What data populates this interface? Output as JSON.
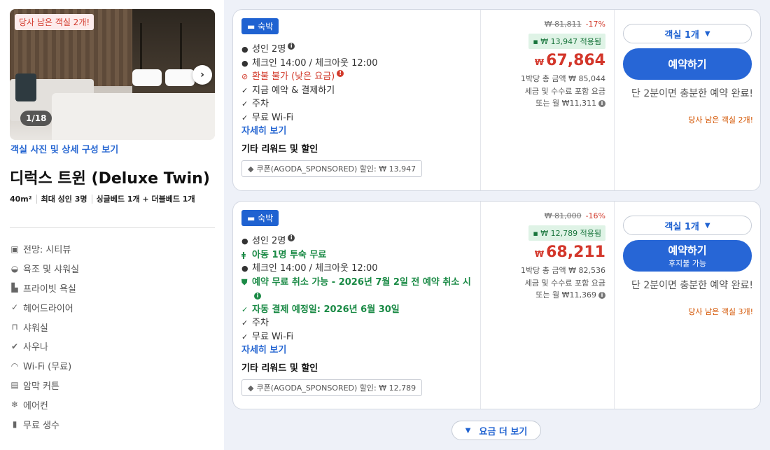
{
  "room": {
    "scarcity_badge": "당사 남은 객실 2개!",
    "photo_counter": "1/18",
    "photo_link": "객실 사진 및 상세 구성 보기",
    "title": "디럭스 트윈 (Deluxe Twin)",
    "specs": [
      "40m²",
      "최대 성인 3명",
      "싱글베드 1개 + 더블베드 1개"
    ],
    "amenities": [
      {
        "icon": "view-icon",
        "label": "전망: 시티뷰"
      },
      {
        "icon": "bathtub-icon",
        "label": "욕조 및 샤워실"
      },
      {
        "icon": "toilet-icon",
        "label": "프라이빗 욕실"
      },
      {
        "icon": "check-icon",
        "label": "헤어드라이어"
      },
      {
        "icon": "shower-icon",
        "label": "샤워실"
      },
      {
        "icon": "check-circle-icon",
        "label": "사우나"
      },
      {
        "icon": "wifi-icon",
        "label": "Wi-Fi (무료)"
      },
      {
        "icon": "curtain-icon",
        "label": "암막 커튼"
      },
      {
        "icon": "snowflake-icon",
        "label": "에어컨"
      },
      {
        "icon": "bottle-icon",
        "label": "무료 생수"
      }
    ]
  },
  "offers": [
    {
      "stay_badge": "숙박",
      "adults": "성인 2명",
      "checkin": "체크인 14:00 / 체크아웃 12:00",
      "refund": "환불 불가 (낮은 요금)",
      "pay_now": "지금 예약 & 결제하기",
      "parking": "주차",
      "wifi": "무료 Wi-Fi",
      "details_link": "자세히 보기",
      "extra_title": "기타 리워드 및 할인",
      "coupon": "쿠폰(AGODA_SPONSORED) 할인: ₩ 13,947",
      "old_price": "₩ 81,811",
      "discount_pct": "-17%",
      "applied": "₩ 13,947 적용됨",
      "currency": "₩",
      "price": "67,864",
      "total_note": "1박당 총 금액 ₩ 85,044",
      "tax_note": "세금 및 수수료 포함 요금",
      "monthly_note": "또는 월 ₩11,311",
      "qty": "객실 1개",
      "book_label": "예약하기",
      "hurry": "단 2분이면 충분한 예약 완료!",
      "rooms_left": "당사 남은 객실 2개!"
    },
    {
      "stay_badge": "숙박",
      "adults": "성인 2명",
      "child": "아동 1명 투숙 무료",
      "checkin": "체크인 14:00 / 체크아웃 12:00",
      "free_cancel": "예약 무료 취소 가능 - 2026년 7월 2일 전 예약 취소 시",
      "auto_pay": "자동 결제 예정일: 2026년 6월 30일",
      "parking": "주차",
      "wifi": "무료 Wi-Fi",
      "details_link": "자세히 보기",
      "extra_title": "기타 리워드 및 할인",
      "coupon": "쿠폰(AGODA_SPONSORED) 할인: ₩ 12,789",
      "old_price": "₩ 81,000",
      "discount_pct": "-16%",
      "applied": "₩ 12,789 적용됨",
      "currency": "₩",
      "price": "68,211",
      "total_note": "1박당 총 금액 ₩ 82,536",
      "tax_note": "세금 및 수수료 포함 요금",
      "monthly_note": "또는 월 ₩11,369",
      "qty": "객실 1개",
      "book_label": "예약하기",
      "book_sub": "후지불 가능",
      "hurry": "단 2분이면 충분한 예약 완료!",
      "rooms_left": "당사 남은 객실 3개!"
    }
  ],
  "more_rates": "요금 더 보기",
  "colors": {
    "accent": "#2766d6",
    "price_red": "#d3362a",
    "green": "#1a8a45",
    "orange": "#d35400"
  }
}
